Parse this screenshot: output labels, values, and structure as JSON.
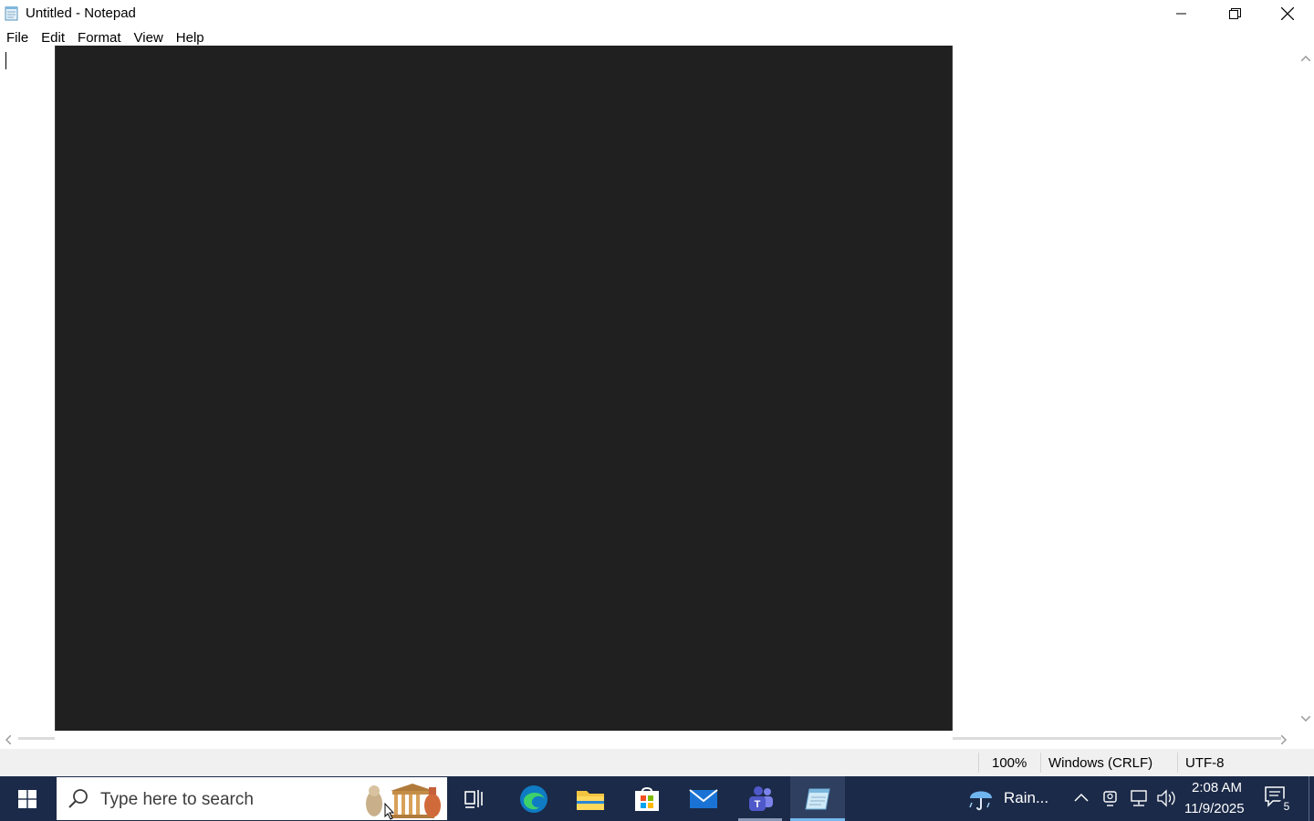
{
  "window": {
    "title": "Untitled - Notepad",
    "controls": {
      "minimize": "minimize",
      "maximize": "restore",
      "close": "close"
    }
  },
  "menu": {
    "items": [
      "File",
      "Edit",
      "Format",
      "View",
      "Help"
    ]
  },
  "editor": {
    "content": ""
  },
  "overlay": {
    "color": "#202020"
  },
  "statusbar": {
    "zoom": "100%",
    "line_ending": "Windows (CRLF)",
    "encoding": "UTF-8"
  },
  "taskbar": {
    "search_placeholder": "Type here to search",
    "apps": [
      {
        "name": "task-view",
        "icon": "task-view-icon"
      },
      {
        "name": "edge",
        "icon": "edge-icon"
      },
      {
        "name": "file-explorer",
        "icon": "folder-icon"
      },
      {
        "name": "microsoft-store",
        "icon": "store-icon"
      },
      {
        "name": "mail",
        "icon": "mail-icon"
      },
      {
        "name": "teams",
        "icon": "teams-icon"
      },
      {
        "name": "notepad",
        "icon": "notepad-icon",
        "active": true
      }
    ],
    "weather": "Rain...",
    "clock_time": "2:08 AM",
    "clock_date": "11/9/2025",
    "notification_count": "5"
  },
  "colors": {
    "taskbar": "#1b2a48",
    "accent": "#76b9ed",
    "statusbar": "#f0f0f0"
  }
}
